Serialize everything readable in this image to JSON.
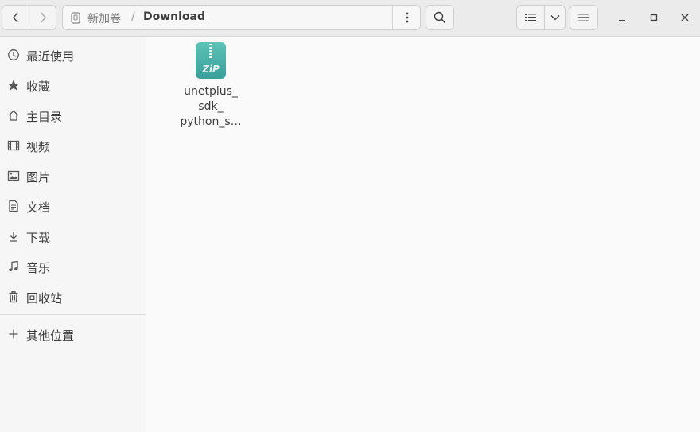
{
  "pathbar": {
    "root_label": "新加卷",
    "separator": "/",
    "current_label": "Download"
  },
  "sidebar": {
    "items": [
      {
        "label": "最近使用",
        "icon": "clock-icon"
      },
      {
        "label": "收藏",
        "icon": "star-icon"
      },
      {
        "label": "主目录",
        "icon": "home-icon"
      },
      {
        "label": "视频",
        "icon": "film-icon"
      },
      {
        "label": "图片",
        "icon": "image-icon"
      },
      {
        "label": "文档",
        "icon": "document-icon"
      },
      {
        "label": "下载",
        "icon": "download-icon"
      },
      {
        "label": "音乐",
        "icon": "music-icon"
      },
      {
        "label": "回收站",
        "icon": "trash-icon"
      }
    ],
    "other_locations": {
      "label": "其他位置",
      "icon": "plus-icon"
    }
  },
  "files": [
    {
      "name_lines": [
        "unetplus_",
        "sdk_",
        "python_s…"
      ],
      "icon": "zip-archive-icon",
      "icon_text": "ZiP"
    }
  ],
  "colors": {
    "zip_icon": "#3a9e9a",
    "zip_icon_light": "#5cc3b8"
  }
}
